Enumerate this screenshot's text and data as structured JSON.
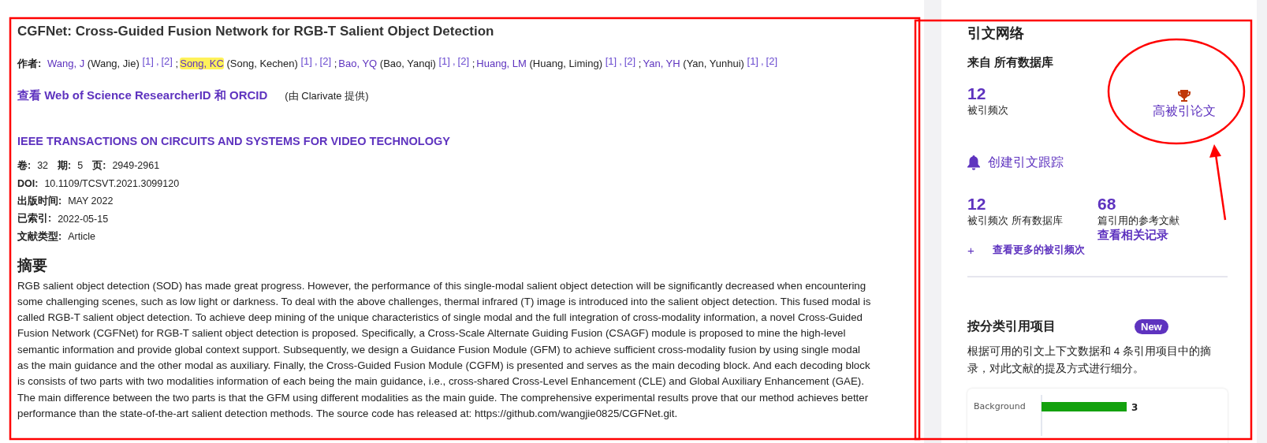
{
  "record": {
    "title": "CGFNet: Cross-Guided Fusion Network for RGB-T Salient Object Detection",
    "authors_label": "作者:",
    "ref_separator": ",",
    "author_separator": ";",
    "authors": [
      {
        "short": "Wang, J",
        "full": "(Wang, Jie)",
        "refs": [
          "[1]",
          "[2]"
        ],
        "highlighted": false
      },
      {
        "short": "Song, KC",
        "full": "(Song, Kechen)",
        "refs": [
          "[1]",
          "[2]"
        ],
        "highlighted": true
      },
      {
        "short": "Bao, YQ",
        "full": "(Bao, Yanqi)",
        "refs": [
          "[1]",
          "[2]"
        ],
        "highlighted": false
      },
      {
        "short": "Huang, LM",
        "full": "(Huang, Liming)",
        "refs": [
          "[1]",
          "[2]"
        ],
        "highlighted": false
      },
      {
        "short": "Yan, YH",
        "full": "(Yan, Yunhui)",
        "refs": [
          "[1]",
          "[2]"
        ],
        "highlighted": false
      }
    ],
    "researcher_link": "查看 Web of Science ResearcherID 和 ORCID",
    "provider_note": "(由 Clarivate 提供)",
    "journal": "IEEE TRANSACTIONS ON CIRCUITS AND SYSTEMS FOR VIDEO TECHNOLOGY",
    "meta": [
      [
        {
          "label": "卷:",
          "value": "32"
        },
        {
          "label": "期:",
          "value": "5"
        },
        {
          "label": "页:",
          "value": "2949-2961"
        }
      ],
      [
        {
          "label": "DOI:",
          "value": "10.1109/TCSVT.2021.3099120"
        }
      ],
      [
        {
          "label": "出版时间:",
          "value": "MAY 2022"
        }
      ],
      [
        {
          "label": "已索引:",
          "value": "2022-05-15"
        }
      ],
      [
        {
          "label": "文献类型:",
          "value": "Article"
        }
      ]
    ],
    "abstract_heading": "摘要",
    "abstract": "RGB salient object detection (SOD) has made great progress. However, the performance of this single-modal salient object detection will be significantly decreased when encountering some challenging scenes, such as low light or darkness. To deal with the above challenges, thermal infrared (T) image is introduced into the salient object detection. This fused modal is called RGB-T salient object detection. To achieve deep mining of the unique characteristics of single modal and the full integration of cross-modality information, a novel Cross-Guided Fusion Network (CGFNet) for RGB-T salient object detection is proposed. Specifically, a Cross-Scale Alternate Guiding Fusion (CSAGF) module is proposed to mine the high-level semantic information and provide global context support. Subsequently, we design a Guidance Fusion Module (GFM) to achieve sufficient cross-modality fusion by using single modal as the main guidance and the other modal as auxiliary. Finally, the Cross-Guided Fusion Module (CGFM) is presented and serves as the main decoding block. And each decoding block is consists of two parts with two modalities information of each being the main guidance, i.e., cross-shared Cross-Level Enhancement (CLE) and Global Auxiliary Enhancement (GAE). The main difference between the two parts is that the GFM using different modalities as the main guide. The comprehensive experimental results prove that our method achieves better performance than the state-of-the-art salient detection methods. The source code has released at: https://github.com/wangjie0825/CGFNet.git."
  },
  "citation_network": {
    "title": "引文网络",
    "source": "来自 所有数据库",
    "times_cited": "12",
    "times_cited_label": "被引频次",
    "highly_cited_label": "高被引论文",
    "create_alert": "创建引文跟踪",
    "stats": [
      {
        "number": "12",
        "label": "被引频次 所有数据库"
      },
      {
        "number": "68",
        "label": "篇引用的参考文献",
        "link": "查看相关记录"
      }
    ],
    "more_link": "查看更多的被引频次",
    "more_icon": "+"
  },
  "citation_categories": {
    "title": "按分类引用项目",
    "badge": "New",
    "description": "根据可用的引文上下文数据和 4 条引用项目中的摘录，对此文献的提及方式进行细分。",
    "chart_data": {
      "type": "bar",
      "orientation": "horizontal",
      "categories": [
        "Background"
      ],
      "values": [
        3
      ],
      "data_labels": true
    }
  }
}
